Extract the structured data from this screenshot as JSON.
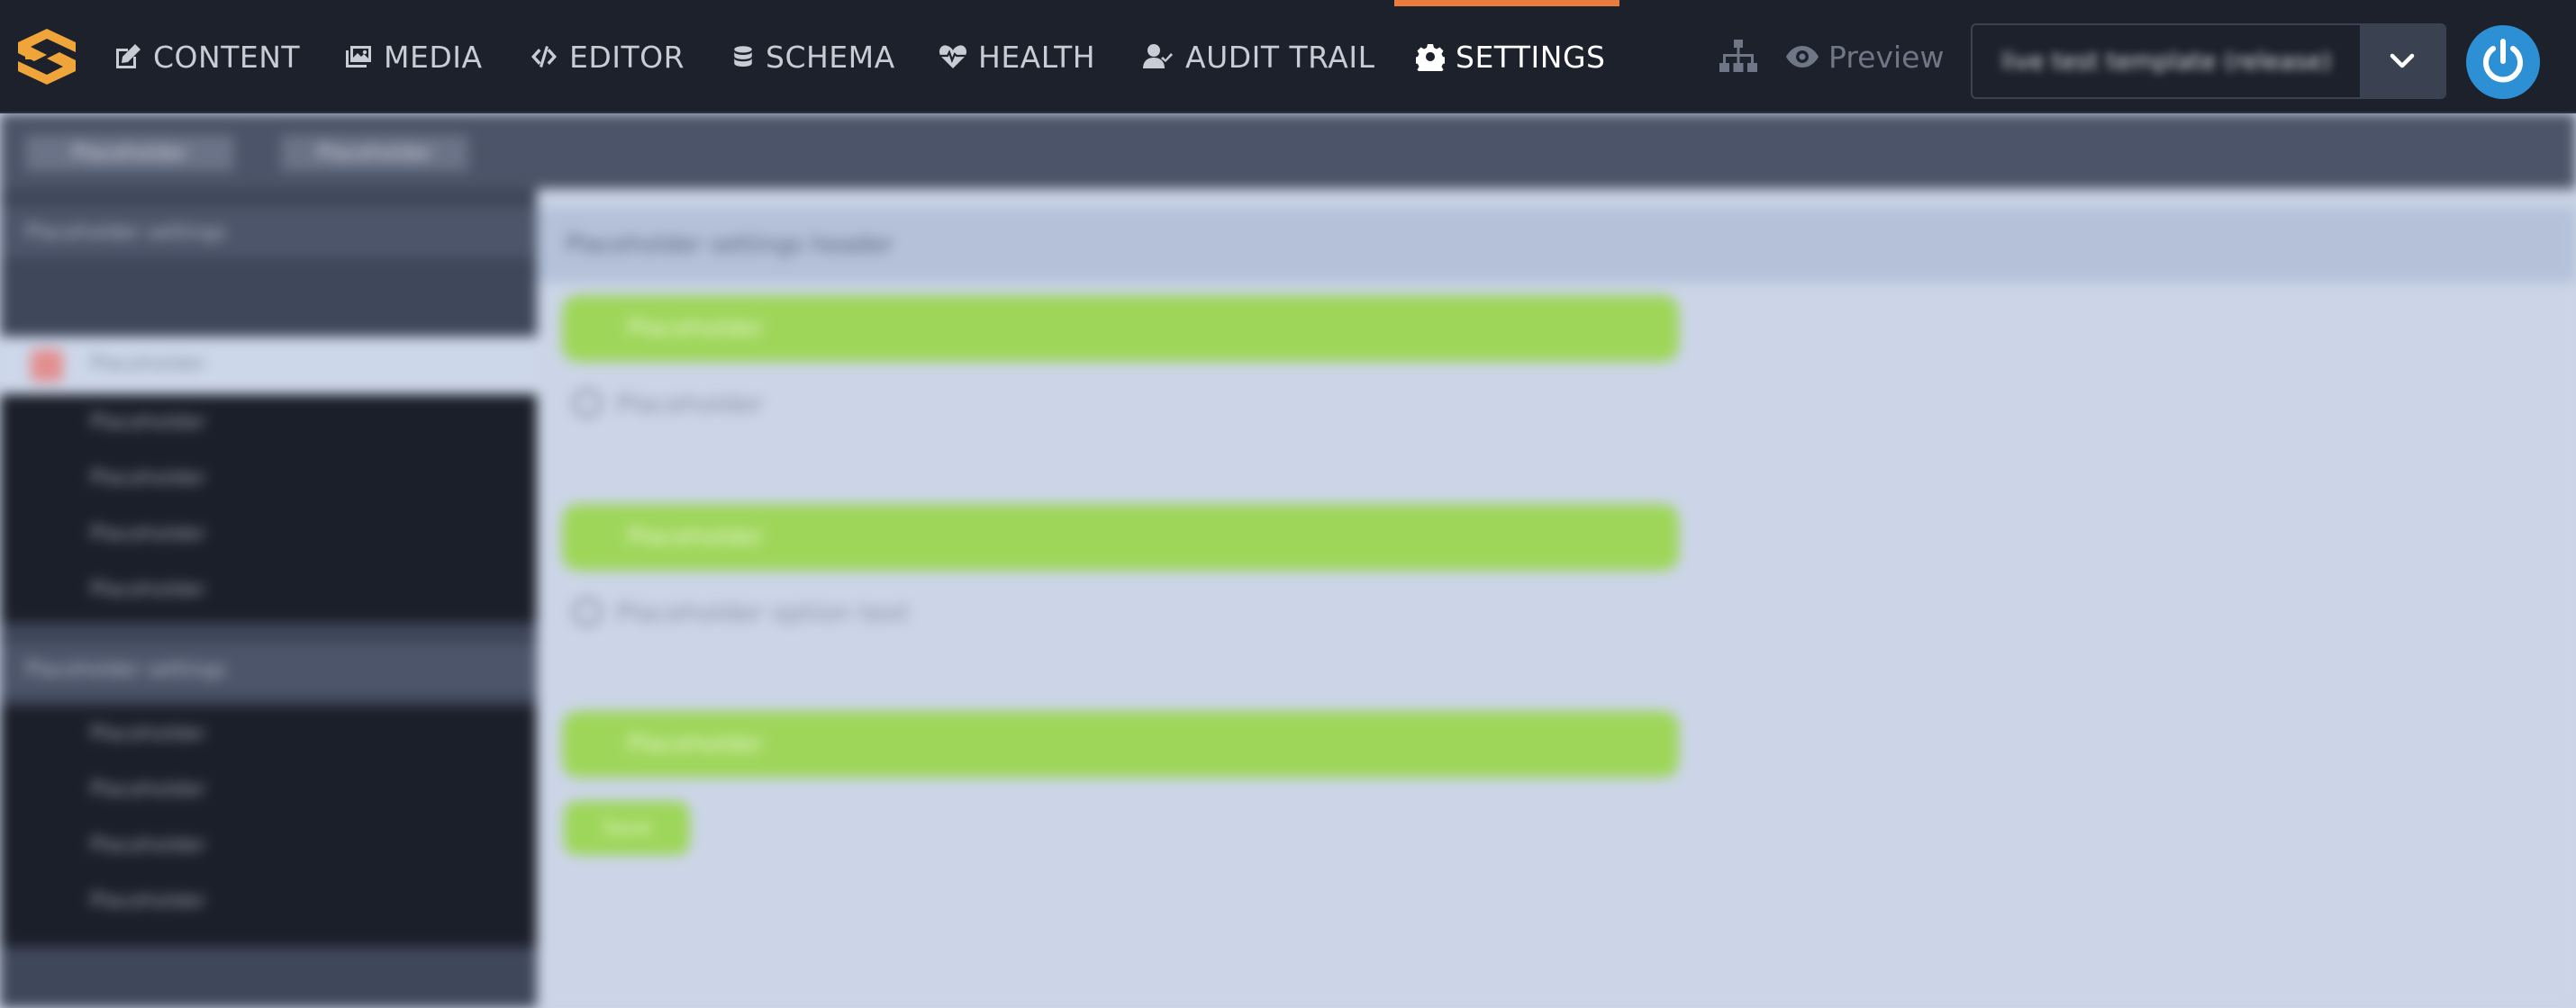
{
  "colors": {
    "topbar_bg": "#1c212b",
    "active_indicator": "#e87d3e",
    "logo_orange": "#f0a53a",
    "power_button": "#2d8fd4",
    "accent_green": "#9ed65a",
    "content_bg": "#cbd5e7",
    "sidebar_dark": "#1b1f29"
  },
  "nav": {
    "items": [
      {
        "label": "CONTENT",
        "icon": "edit-icon",
        "active": false
      },
      {
        "label": "MEDIA",
        "icon": "images-icon",
        "active": false
      },
      {
        "label": "EDITOR",
        "icon": "code-icon",
        "active": false
      },
      {
        "label": "SCHEMA",
        "icon": "database-icon",
        "active": false
      },
      {
        "label": "HEALTH",
        "icon": "heartbeat-icon",
        "active": false
      },
      {
        "label": "AUDIT TRAIL",
        "icon": "user-check-icon",
        "active": false
      },
      {
        "label": "SETTINGS",
        "icon": "gear-icon",
        "active": true
      }
    ],
    "preview_label": "Preview",
    "sitemap_icon": "sitemap-icon",
    "power_icon": "power-icon"
  },
  "environment": {
    "selected": "live test template (release)"
  },
  "blurred": {
    "subtabs": [
      "Placeholder",
      "Placeholder"
    ],
    "sidebar_sections": [
      "Placeholder settings",
      "Placeholder settings"
    ],
    "sidebar_selected": "Placeholder",
    "sidebar_list_a": [
      "Placeholder",
      "Placeholder",
      "Placeholder",
      "Placeholder"
    ],
    "sidebar_list_b": [
      "Placeholder",
      "Placeholder",
      "Placeholder",
      "Placeholder"
    ],
    "main_header": "Placeholder settings header",
    "bars": [
      "Placeholder",
      "Placeholder",
      "Placeholder"
    ],
    "options": [
      "Placeholder",
      "Placeholder option text"
    ],
    "button": "Save"
  }
}
